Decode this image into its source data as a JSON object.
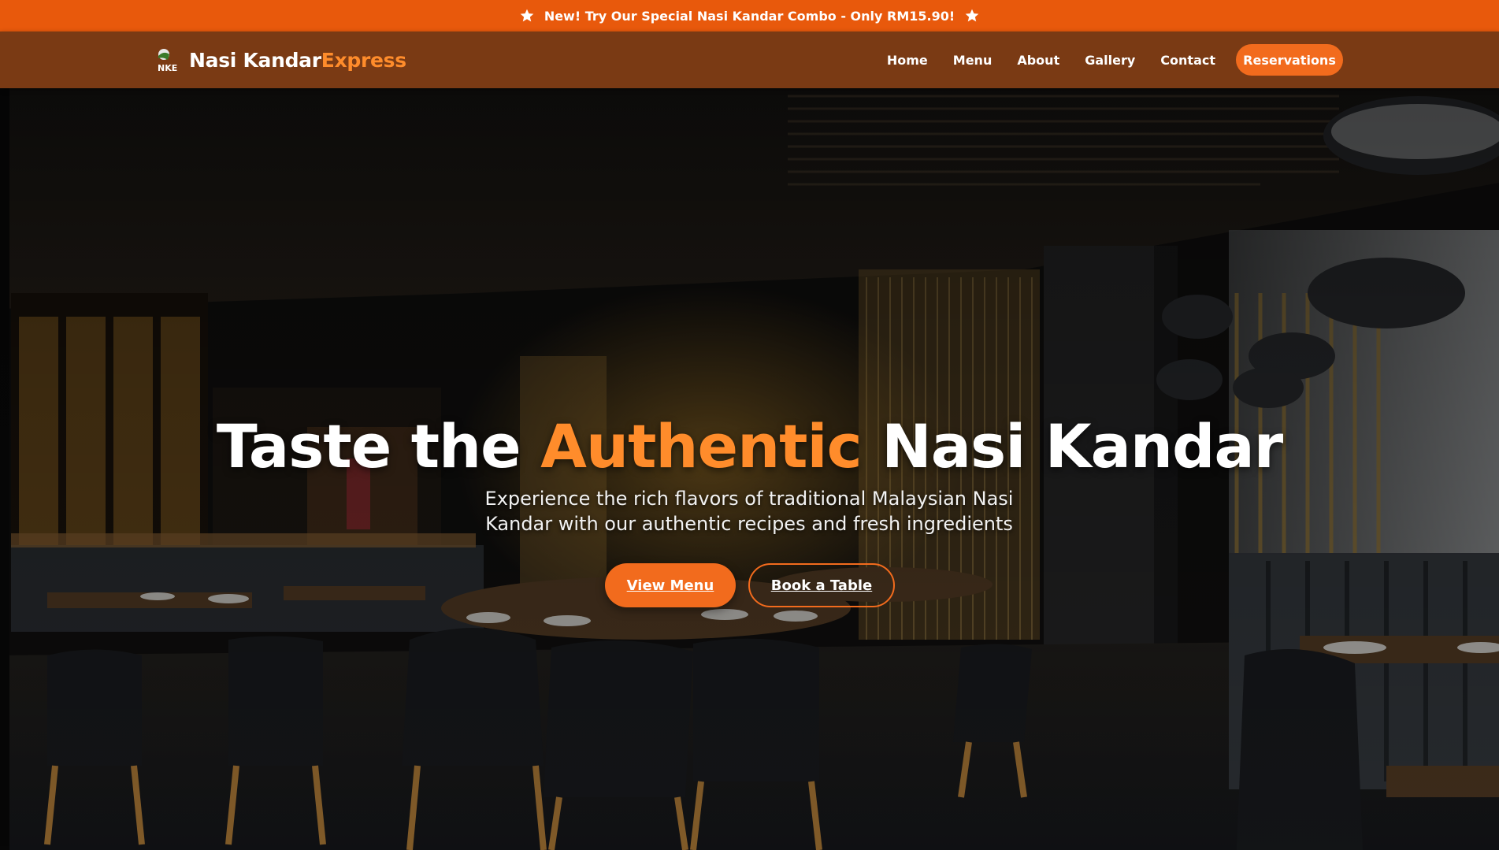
{
  "announcement": {
    "text": "New! Try Our Special Nasi Kandar Combo - Only RM15.90!",
    "icon": "star-icon"
  },
  "brand": {
    "name_primary": "Nasi Kandar",
    "name_accent": "Express",
    "logo_initials": "NKE"
  },
  "nav": {
    "items": [
      {
        "label": "Home"
      },
      {
        "label": "Menu"
      },
      {
        "label": "About"
      },
      {
        "label": "Gallery"
      },
      {
        "label": "Contact"
      }
    ],
    "cta_label": "Reservations"
  },
  "hero": {
    "title_before": "Taste the",
    "title_accent": "Authentic",
    "title_after": "Nasi Kandar",
    "subtitle": "Experience the rich flavors of traditional Malaysian Nasi Kandar with our authentic recipes and fresh ingredients",
    "primary_button": "View Menu",
    "secondary_button": "Book a Table",
    "background": "restaurant-interior-photo"
  },
  "colors": {
    "announce_bg": "#e8590c",
    "nav_bg": "#7a3a14",
    "accent": "#ff8c2b",
    "button": "#f26b1d"
  }
}
